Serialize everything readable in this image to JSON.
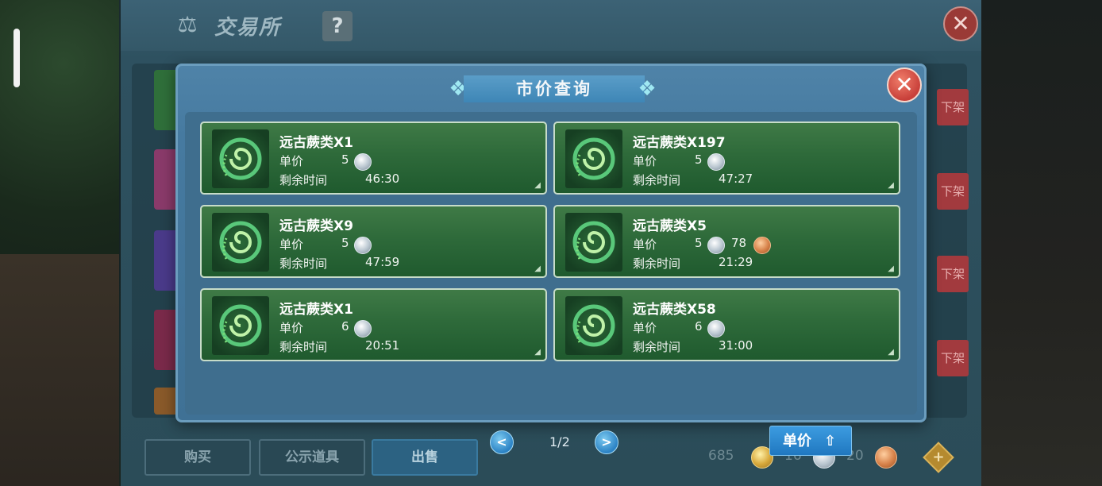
{
  "exchange": {
    "title": "交易所",
    "help_label": "?",
    "close_label": "✕",
    "off_shelf_label": "下架",
    "tabs": [
      {
        "label": "购买",
        "active": false
      },
      {
        "label": "公示道具",
        "active": false
      },
      {
        "label": "出售",
        "active": true
      }
    ],
    "currency": {
      "gold": "685",
      "silver": "16",
      "bronze": "20",
      "add_label": "+"
    }
  },
  "modal": {
    "title": "市价查询",
    "close_label": "✕",
    "price_label": "单价",
    "time_label": "剩余时间",
    "listings": [
      {
        "name": "远古蕨类X1",
        "silver": "5",
        "bronze": "",
        "time": "46:30"
      },
      {
        "name": "远古蕨类X197",
        "silver": "5",
        "bronze": "",
        "time": "47:27"
      },
      {
        "name": "远古蕨类X9",
        "silver": "5",
        "bronze": "",
        "time": "47:59"
      },
      {
        "name": "远古蕨类X5",
        "silver": "5",
        "bronze": "78",
        "time": "21:29"
      },
      {
        "name": "远古蕨类X1",
        "silver": "6",
        "bronze": "",
        "time": "20:51"
      },
      {
        "name": "远古蕨类X58",
        "silver": "6",
        "bronze": "",
        "time": "31:00"
      }
    ],
    "pager": {
      "prev": "<",
      "next": ">",
      "indicator": "1/2"
    },
    "sort": {
      "label": "单价",
      "arrow": "⇧"
    }
  },
  "colors": {
    "modal_bg": "#467aa0",
    "card_green": "#2e6a3a",
    "sort_blue": "#2a86d0",
    "close_red": "#d24a40"
  }
}
